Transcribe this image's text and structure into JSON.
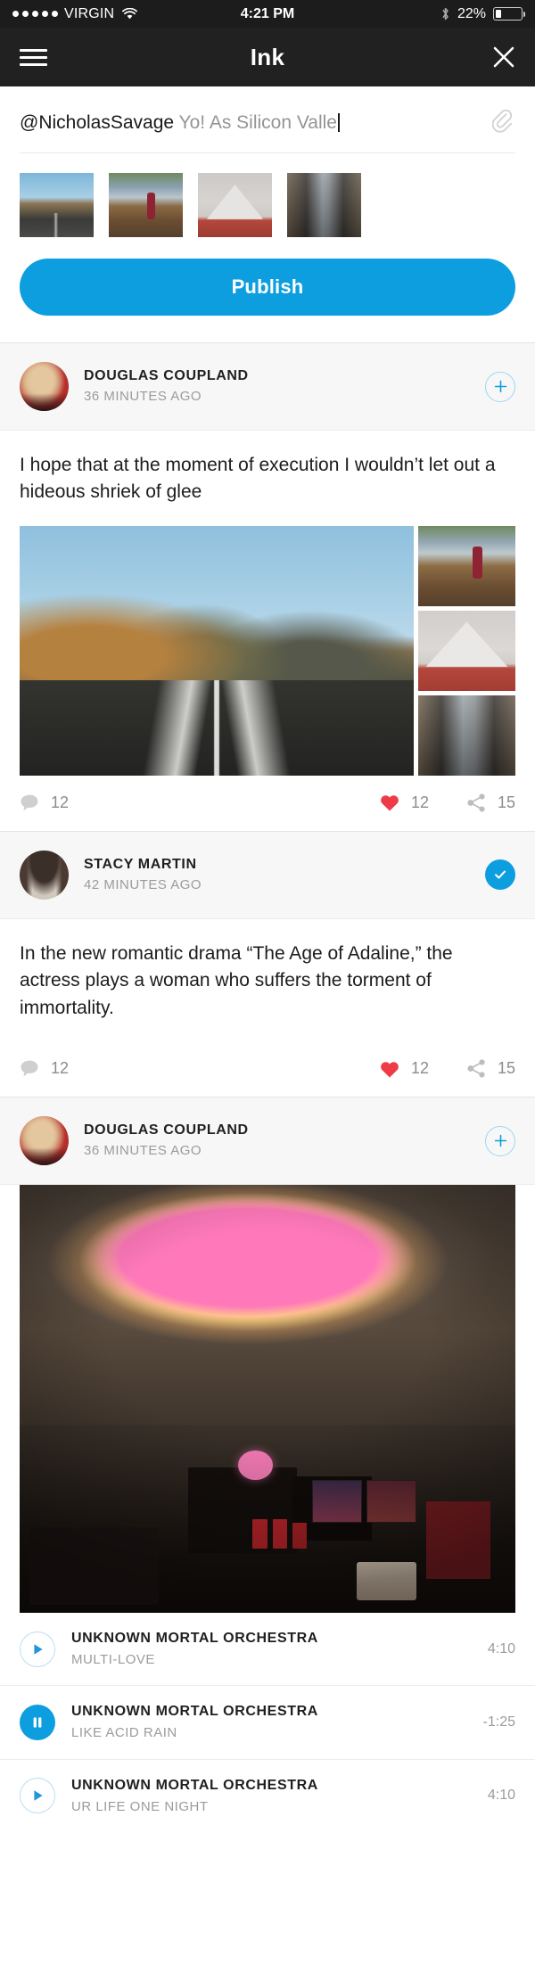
{
  "status_bar": {
    "signal_dots": 5,
    "carrier": "VIRGIN",
    "wifi_icon": "wifi-icon",
    "time": "4:21 PM",
    "bluetooth_icon": "bluetooth-icon",
    "battery_percent": "22%",
    "battery_level": 22
  },
  "nav": {
    "menu_icon": "hamburger-menu-icon",
    "title": "Ink",
    "close_icon": "close-icon"
  },
  "compose": {
    "handle": "@NicholasSavage",
    "draft_text": "Yo! As Silicon Valle",
    "placeholder": "Yo! As Silicon Valle",
    "attach_icon": "paperclip-icon",
    "publish_label": "Publish",
    "attachments": [
      {
        "name": "desert-road-thumbnail"
      },
      {
        "name": "woman-lakeshore-thumbnail"
      },
      {
        "name": "snow-mountain-thumbnail"
      },
      {
        "name": "rainy-street-thumbnail"
      }
    ]
  },
  "colors": {
    "accent": "#0d9ee0",
    "heart": "#ee3b45",
    "status_bar_bg": "#1c1c1c",
    "nav_bg": "#212121",
    "muted_text": "#9b9b9b"
  },
  "posts": [
    {
      "author": "DOUGLAS COUPLAND",
      "time": "36 MINUTES AGO",
      "follow_state": "add",
      "follow_icon": "plus-icon",
      "text": "I hope that at the moment of execution I wouldn’t let out a hideous shriek of glee",
      "media": "photo-collage",
      "actions": {
        "comment_icon": "comment-bubble-icon",
        "comment_count": "12",
        "like_icon": "heart-icon",
        "like_count": "12",
        "share_icon": "share-icon",
        "share_count": "15"
      }
    },
    {
      "author": "STACY MARTIN",
      "time": "42 MINUTES AGO",
      "follow_state": "following",
      "follow_icon": "check-icon",
      "text": "In the new romantic drama “The Age of Adaline,” the actress plays a woman who suffers the torment of immortality.",
      "media": "none",
      "actions": {
        "comment_icon": "comment-bubble-icon",
        "comment_count": "12",
        "like_icon": "heart-icon",
        "like_count": "12",
        "share_icon": "share-icon",
        "share_count": "15"
      }
    },
    {
      "author": "DOUGLAS COUPLAND",
      "time": "36 MINUTES AGO",
      "follow_state": "add",
      "follow_icon": "plus-icon",
      "media": "album-art"
    }
  ],
  "tracks": [
    {
      "artist": "UNKNOWN MORTAL ORCHESTRA",
      "title": "MULTI-LOVE",
      "duration": "4:10",
      "state": "paused",
      "icon": "play-icon"
    },
    {
      "artist": "UNKNOWN MORTAL ORCHESTRA",
      "title": "LIKE ACID RAIN",
      "duration": "-1:25",
      "state": "playing",
      "icon": "pause-icon"
    },
    {
      "artist": "UNKNOWN MORTAL ORCHESTRA",
      "title": "UR LIFE ONE NIGHT",
      "duration": "4:10",
      "state": "paused",
      "icon": "play-icon"
    }
  ]
}
